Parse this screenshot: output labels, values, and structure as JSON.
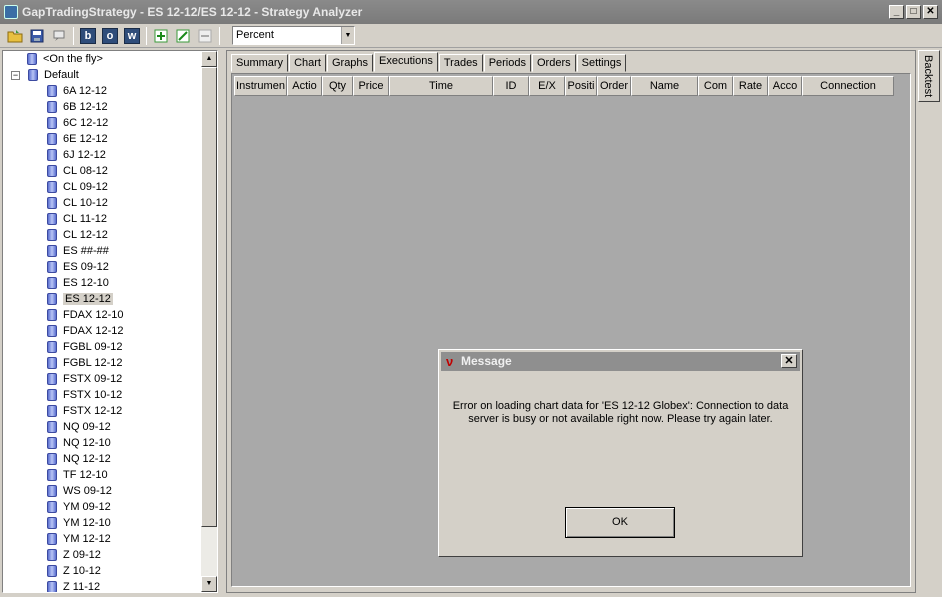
{
  "window": {
    "title": "GapTradingStrategy - ES 12-12/ES 12-12 - Strategy Analyzer",
    "buttons": [
      "_",
      "□",
      "✕"
    ]
  },
  "toolbar": {
    "letter_buttons": [
      "b",
      "o",
      "w"
    ],
    "display_select_value": "Percent"
  },
  "tree": {
    "on_the_fly": "<On the fly>",
    "default_group": "Default",
    "expander": "−",
    "selected": "ES 12-12",
    "items": [
      "6A 12-12",
      "6B 12-12",
      "6C 12-12",
      "6E 12-12",
      "6J 12-12",
      "CL 08-12",
      "CL 09-12",
      "CL 10-12",
      "CL 11-12",
      "CL 12-12",
      "ES ##-##",
      "ES 09-12",
      "ES 12-10",
      "ES 12-12",
      "FDAX 12-10",
      "FDAX 12-12",
      "FGBL 09-12",
      "FGBL 12-12",
      "FSTX 09-12",
      "FSTX 10-12",
      "FSTX 12-12",
      "NQ 09-12",
      "NQ 12-10",
      "NQ 12-12",
      "TF 12-10",
      "WS 09-12",
      "YM 09-12",
      "YM 12-10",
      "YM 12-12",
      "Z 09-12",
      "Z 10-12",
      "Z 11-12"
    ]
  },
  "tabs": [
    "Summary",
    "Chart",
    "Graphs",
    "Executions",
    "Trades",
    "Periods",
    "Orders",
    "Settings"
  ],
  "active_tab": "Executions",
  "grid": {
    "columns": [
      "Instrumen",
      "Actio",
      "Qty",
      "Price",
      "Time",
      "ID",
      "E/X",
      "Positi",
      "Order",
      "Name",
      "Com",
      "Rate",
      "Acco",
      "Connection"
    ]
  },
  "side_tab": "Backtest",
  "dialog": {
    "title": "Message",
    "logo": "ν",
    "close": "✕",
    "message_line1": "Error on loading chart data for 'ES 12-12 Globex': Connection to data",
    "message_line2": "server is busy or not available right now. Please try again later.",
    "ok_label": "OK"
  }
}
